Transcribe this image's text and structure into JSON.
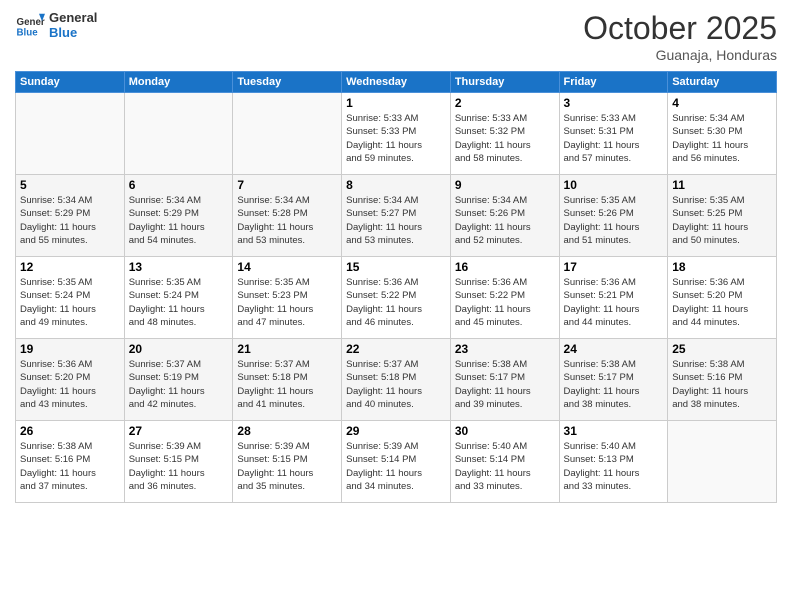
{
  "header": {
    "logo_line1": "General",
    "logo_line2": "Blue",
    "month_title": "October 2025",
    "subtitle": "Guanaja, Honduras"
  },
  "days_of_week": [
    "Sunday",
    "Monday",
    "Tuesday",
    "Wednesday",
    "Thursday",
    "Friday",
    "Saturday"
  ],
  "weeks": [
    [
      {
        "day": "",
        "info": ""
      },
      {
        "day": "",
        "info": ""
      },
      {
        "day": "",
        "info": ""
      },
      {
        "day": "1",
        "info": "Sunrise: 5:33 AM\nSunset: 5:33 PM\nDaylight: 11 hours\nand 59 minutes."
      },
      {
        "day": "2",
        "info": "Sunrise: 5:33 AM\nSunset: 5:32 PM\nDaylight: 11 hours\nand 58 minutes."
      },
      {
        "day": "3",
        "info": "Sunrise: 5:33 AM\nSunset: 5:31 PM\nDaylight: 11 hours\nand 57 minutes."
      },
      {
        "day": "4",
        "info": "Sunrise: 5:34 AM\nSunset: 5:30 PM\nDaylight: 11 hours\nand 56 minutes."
      }
    ],
    [
      {
        "day": "5",
        "info": "Sunrise: 5:34 AM\nSunset: 5:29 PM\nDaylight: 11 hours\nand 55 minutes."
      },
      {
        "day": "6",
        "info": "Sunrise: 5:34 AM\nSunset: 5:29 PM\nDaylight: 11 hours\nand 54 minutes."
      },
      {
        "day": "7",
        "info": "Sunrise: 5:34 AM\nSunset: 5:28 PM\nDaylight: 11 hours\nand 53 minutes."
      },
      {
        "day": "8",
        "info": "Sunrise: 5:34 AM\nSunset: 5:27 PM\nDaylight: 11 hours\nand 53 minutes."
      },
      {
        "day": "9",
        "info": "Sunrise: 5:34 AM\nSunset: 5:26 PM\nDaylight: 11 hours\nand 52 minutes."
      },
      {
        "day": "10",
        "info": "Sunrise: 5:35 AM\nSunset: 5:26 PM\nDaylight: 11 hours\nand 51 minutes."
      },
      {
        "day": "11",
        "info": "Sunrise: 5:35 AM\nSunset: 5:25 PM\nDaylight: 11 hours\nand 50 minutes."
      }
    ],
    [
      {
        "day": "12",
        "info": "Sunrise: 5:35 AM\nSunset: 5:24 PM\nDaylight: 11 hours\nand 49 minutes."
      },
      {
        "day": "13",
        "info": "Sunrise: 5:35 AM\nSunset: 5:24 PM\nDaylight: 11 hours\nand 48 minutes."
      },
      {
        "day": "14",
        "info": "Sunrise: 5:35 AM\nSunset: 5:23 PM\nDaylight: 11 hours\nand 47 minutes."
      },
      {
        "day": "15",
        "info": "Sunrise: 5:36 AM\nSunset: 5:22 PM\nDaylight: 11 hours\nand 46 minutes."
      },
      {
        "day": "16",
        "info": "Sunrise: 5:36 AM\nSunset: 5:22 PM\nDaylight: 11 hours\nand 45 minutes."
      },
      {
        "day": "17",
        "info": "Sunrise: 5:36 AM\nSunset: 5:21 PM\nDaylight: 11 hours\nand 44 minutes."
      },
      {
        "day": "18",
        "info": "Sunrise: 5:36 AM\nSunset: 5:20 PM\nDaylight: 11 hours\nand 44 minutes."
      }
    ],
    [
      {
        "day": "19",
        "info": "Sunrise: 5:36 AM\nSunset: 5:20 PM\nDaylight: 11 hours\nand 43 minutes."
      },
      {
        "day": "20",
        "info": "Sunrise: 5:37 AM\nSunset: 5:19 PM\nDaylight: 11 hours\nand 42 minutes."
      },
      {
        "day": "21",
        "info": "Sunrise: 5:37 AM\nSunset: 5:18 PM\nDaylight: 11 hours\nand 41 minutes."
      },
      {
        "day": "22",
        "info": "Sunrise: 5:37 AM\nSunset: 5:18 PM\nDaylight: 11 hours\nand 40 minutes."
      },
      {
        "day": "23",
        "info": "Sunrise: 5:38 AM\nSunset: 5:17 PM\nDaylight: 11 hours\nand 39 minutes."
      },
      {
        "day": "24",
        "info": "Sunrise: 5:38 AM\nSunset: 5:17 PM\nDaylight: 11 hours\nand 38 minutes."
      },
      {
        "day": "25",
        "info": "Sunrise: 5:38 AM\nSunset: 5:16 PM\nDaylight: 11 hours\nand 38 minutes."
      }
    ],
    [
      {
        "day": "26",
        "info": "Sunrise: 5:38 AM\nSunset: 5:16 PM\nDaylight: 11 hours\nand 37 minutes."
      },
      {
        "day": "27",
        "info": "Sunrise: 5:39 AM\nSunset: 5:15 PM\nDaylight: 11 hours\nand 36 minutes."
      },
      {
        "day": "28",
        "info": "Sunrise: 5:39 AM\nSunset: 5:15 PM\nDaylight: 11 hours\nand 35 minutes."
      },
      {
        "day": "29",
        "info": "Sunrise: 5:39 AM\nSunset: 5:14 PM\nDaylight: 11 hours\nand 34 minutes."
      },
      {
        "day": "30",
        "info": "Sunrise: 5:40 AM\nSunset: 5:14 PM\nDaylight: 11 hours\nand 33 minutes."
      },
      {
        "day": "31",
        "info": "Sunrise: 5:40 AM\nSunset: 5:13 PM\nDaylight: 11 hours\nand 33 minutes."
      },
      {
        "day": "",
        "info": ""
      }
    ]
  ]
}
